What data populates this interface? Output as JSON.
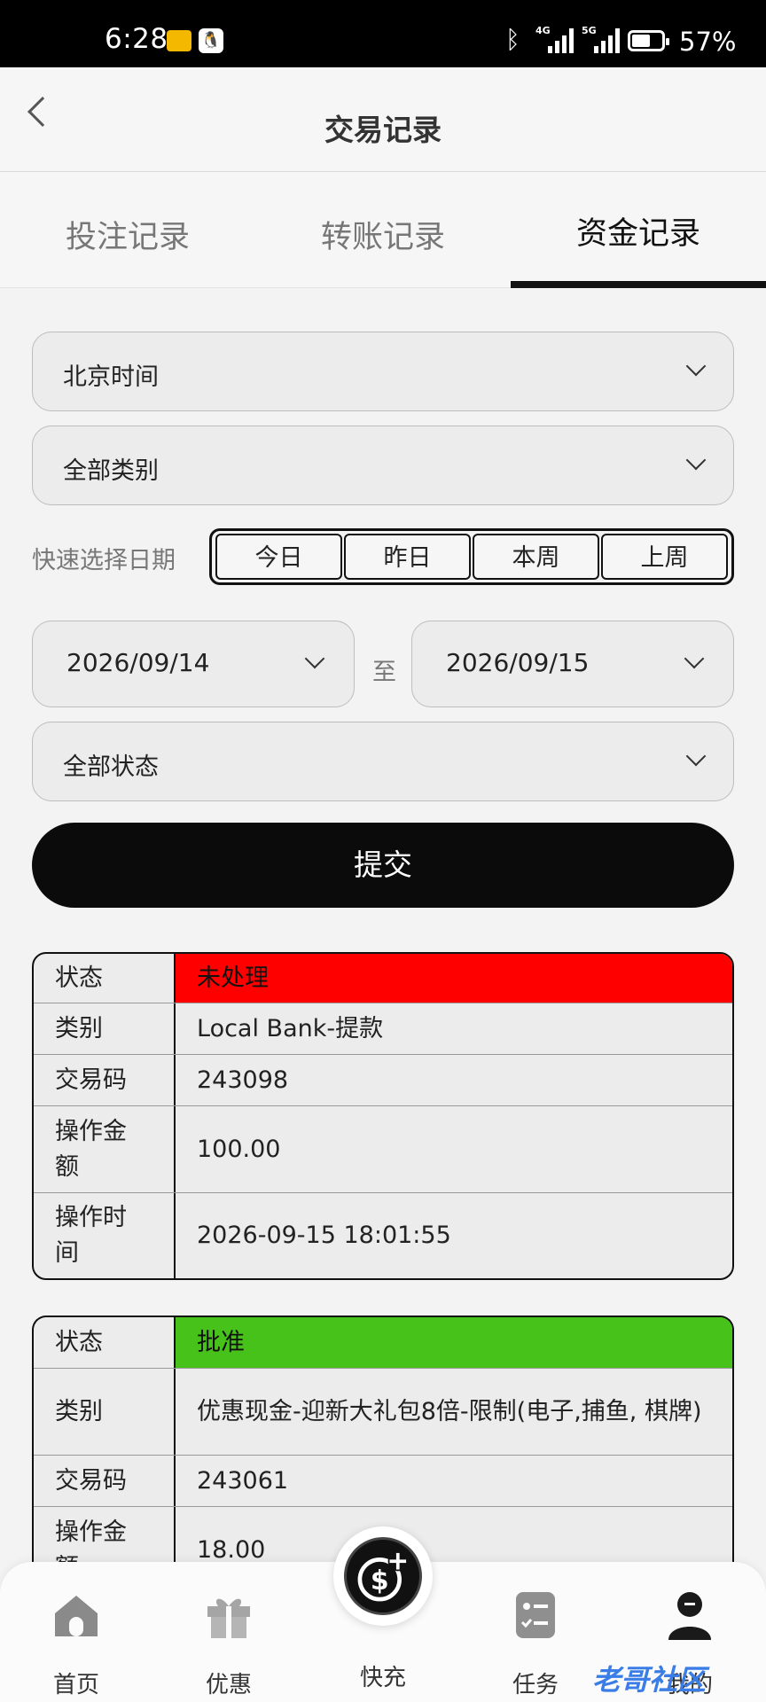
{
  "status_bar": {
    "time": "6:28",
    "battery": "57%",
    "net1": "4G",
    "net2": "5G"
  },
  "header": {
    "title": "交易记录"
  },
  "tabs": [
    {
      "label": "投注记录"
    },
    {
      "label": "转账记录"
    },
    {
      "label": "资金记录"
    }
  ],
  "filters": {
    "timezone": "北京时间",
    "category": "全部类别",
    "quick_label": "快速选择日期",
    "quick": [
      "今日",
      "昨日",
      "本周",
      "上周"
    ],
    "date_from": "2026/09/14",
    "to_label": "至",
    "date_to": "2026/09/15",
    "status": "全部状态",
    "submit": "提交"
  },
  "records": [
    {
      "status_key": "状态",
      "status": "未处理",
      "status_color": "#ff0000",
      "type_key": "类别",
      "type": "Local Bank-提款",
      "code_key": "交易码",
      "code": "243098",
      "amount_key": "操作金额",
      "amount": "100.00",
      "time_key": "操作时间",
      "time": "2026-09-15 18:01:55"
    },
    {
      "status_key": "状态",
      "status": "批准",
      "status_color": "#47c21a",
      "type_key": "类别",
      "type": "优惠现金-迎新大礼包8倍-限制(电子,捕鱼, 棋牌)",
      "code_key": "交易码",
      "code": "243061",
      "amount_key": "操作金额",
      "amount": "18.00"
    }
  ],
  "tabbar": [
    {
      "label": "首页",
      "icon": "home-icon"
    },
    {
      "label": "优惠",
      "icon": "gift-icon"
    },
    {
      "label": "快充",
      "icon": "recharge-icon"
    },
    {
      "label": "任务",
      "icon": "task-icon"
    },
    {
      "label": "我的",
      "icon": "user-icon"
    }
  ],
  "watermark": "老哥社区"
}
